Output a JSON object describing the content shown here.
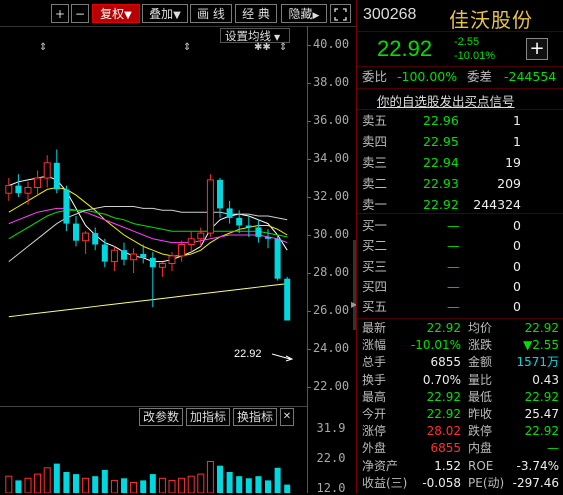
{
  "toolbar": {
    "plus": "+",
    "minus": "−",
    "fuquan": "复权",
    "fuquan_arrow": "▼",
    "diejia": "叠加",
    "diejia_arrow": "▼",
    "huaxian": "画 线",
    "jingdian": "经 典",
    "yincang": "隐藏",
    "yincang_arrow": "▶"
  },
  "chart": {
    "settings_label": "设置均线",
    "settings_arrow": "▼",
    "price_tag": "22.92",
    "axis_ticks": [
      "40.00",
      "38.00",
      "36.00",
      "34.00",
      "32.00",
      "30.00",
      "28.00",
      "26.00",
      "24.00",
      "22.00"
    ],
    "sub_axis_ticks": [
      "31.9",
      "22.0",
      "12.0"
    ],
    "buttons": {
      "params": "改参数",
      "add": "加指标",
      "swap": "换指标",
      "close": "✕"
    },
    "chart_data": {
      "type": "candlestick",
      "ylim": [
        21.0,
        41.0
      ],
      "candles": [
        [
          32.2,
          33.0,
          31.8,
          32.6
        ],
        [
          32.6,
          33.2,
          32.0,
          32.2
        ],
        [
          32.2,
          32.8,
          31.6,
          32.5
        ],
        [
          32.5,
          33.4,
          32.1,
          33.0
        ],
        [
          33.0,
          34.2,
          32.5,
          33.8
        ],
        [
          33.8,
          34.5,
          32.2,
          32.4
        ],
        [
          32.4,
          32.6,
          30.2,
          30.6
        ],
        [
          30.6,
          31.0,
          29.4,
          29.7
        ],
        [
          29.7,
          30.2,
          29.0,
          30.1
        ],
        [
          30.1,
          30.4,
          29.2,
          29.5
        ],
        [
          29.5,
          29.8,
          28.3,
          28.6
        ],
        [
          28.6,
          29.4,
          28.1,
          29.2
        ],
        [
          29.2,
          29.6,
          28.4,
          28.7
        ],
        [
          28.7,
          29.3,
          28.0,
          29.0
        ],
        [
          29.0,
          29.5,
          28.5,
          28.8
        ],
        [
          28.8,
          29.1,
          26.2,
          28.3
        ],
        [
          28.3,
          28.6,
          27.8,
          28.5
        ],
        [
          28.5,
          29.1,
          28.1,
          28.9
        ],
        [
          28.9,
          29.7,
          28.6,
          29.5
        ],
        [
          29.5,
          30.2,
          29.1,
          29.8
        ],
        [
          29.8,
          30.4,
          29.4,
          30.1
        ],
        [
          30.1,
          33.2,
          29.9,
          32.9
        ],
        [
          32.9,
          33.0,
          30.9,
          31.4
        ],
        [
          31.4,
          31.8,
          30.6,
          30.9
        ],
        [
          30.9,
          31.3,
          30.1,
          30.5
        ],
        [
          30.5,
          31.0,
          29.9,
          30.4
        ],
        [
          30.4,
          30.8,
          29.6,
          29.9
        ],
        [
          29.9,
          30.3,
          29.3,
          29.8
        ],
        [
          29.8,
          30.0,
          27.6,
          27.7
        ],
        [
          27.7,
          27.8,
          25.5,
          25.5
        ]
      ],
      "ma": [
        {
          "name": "MA5",
          "color": "#ffffff",
          "values": [
            32.6,
            32.8,
            32.9,
            33.0,
            33.1,
            32.9,
            32.3,
            31.4,
            30.5,
            30.0,
            29.6,
            29.4,
            29.1,
            28.9,
            28.8,
            28.6,
            28.6,
            28.7,
            28.9,
            29.1,
            29.4,
            30.3,
            30.8,
            31.0,
            31.1,
            31.0,
            30.8,
            30.6,
            30.0,
            29.2
          ]
        },
        {
          "name": "MA10",
          "color": "#f0f000",
          "values": [
            31.2,
            31.5,
            31.8,
            32.1,
            32.4,
            32.5,
            32.4,
            32.1,
            31.7,
            31.3,
            30.8,
            30.4,
            30.0,
            29.7,
            29.4,
            29.2,
            29.0,
            28.9,
            28.9,
            29.0,
            29.2,
            29.6,
            29.9,
            30.1,
            30.3,
            30.4,
            30.5,
            30.5,
            30.3,
            30.0
          ]
        },
        {
          "name": "MA20",
          "color": "#ff40ff",
          "values": [
            30.6,
            30.8,
            31.0,
            31.2,
            31.3,
            31.4,
            31.4,
            31.3,
            31.2,
            31.0,
            30.8,
            30.6,
            30.4,
            30.2,
            30.0,
            29.8,
            29.7,
            29.6,
            29.6,
            29.6,
            29.7,
            29.8,
            29.9,
            30.0,
            30.0,
            30.0,
            30.0,
            29.9,
            29.8,
            29.6
          ]
        },
        {
          "name": "MA30",
          "color": "#00e000",
          "values": [
            29.8,
            30.1,
            30.4,
            30.7,
            31.0,
            31.2,
            31.3,
            31.3,
            31.3,
            31.2,
            31.1,
            30.9,
            30.8,
            30.6,
            30.5,
            30.4,
            30.3,
            30.2,
            30.2,
            30.2,
            30.2,
            30.2,
            30.2,
            30.2,
            30.2,
            30.2,
            30.2,
            30.1,
            30.0,
            29.9
          ]
        },
        {
          "name": "MA60",
          "color": "#d0d0d0",
          "values": [
            28.6,
            29.0,
            29.4,
            29.8,
            30.2,
            30.6,
            30.9,
            31.1,
            31.3,
            31.4,
            31.5,
            31.5,
            31.5,
            31.5,
            31.4,
            31.4,
            31.3,
            31.3,
            31.2,
            31.2,
            31.2,
            31.2,
            31.2,
            31.1,
            31.1,
            31.1,
            31.0,
            31.0,
            30.9,
            30.8
          ]
        },
        {
          "name": "MA120",
          "color": "#ffff80",
          "values": [
            25.7,
            25.76,
            25.82,
            25.88,
            25.94,
            26.0,
            26.06,
            26.12,
            26.18,
            26.24,
            26.3,
            26.36,
            26.42,
            26.48,
            26.54,
            26.6,
            26.66,
            26.72,
            26.78,
            26.84,
            26.9,
            26.96,
            27.02,
            27.08,
            27.14,
            27.2,
            27.26,
            27.32,
            27.38,
            27.44
          ]
        }
      ],
      "volumes": [
        8,
        6,
        7,
        9,
        12,
        14,
        10,
        9,
        7,
        8,
        11,
        6,
        7,
        5,
        6,
        9,
        7,
        6,
        7,
        8,
        9,
        15,
        13,
        10,
        8,
        7,
        8,
        6,
        12,
        4
      ],
      "volume_max": 31.9
    }
  },
  "quote": {
    "code": "300268",
    "name": "佳沃股份",
    "price": "22.92",
    "change": "-2.55",
    "change_pct": "-10.01%",
    "add_btn": "+",
    "weibi_label": "委比",
    "weibi_value": "-100.00%",
    "weicha_label": "委差",
    "weicha_value": "-244554",
    "signal": "你的自选股发出买点信号",
    "asks": [
      {
        "label": "卖五",
        "price": "22.96",
        "vol": "1"
      },
      {
        "label": "卖四",
        "price": "22.95",
        "vol": "1"
      },
      {
        "label": "卖三",
        "price": "22.94",
        "vol": "19"
      },
      {
        "label": "卖二",
        "price": "22.93",
        "vol": "209"
      },
      {
        "label": "卖一",
        "price": "22.92",
        "vol": "244324"
      }
    ],
    "bids": [
      {
        "label": "买一",
        "price": "—",
        "vol": "0"
      },
      {
        "label": "买二",
        "price": "—",
        "vol": "0"
      },
      {
        "label": "买三",
        "price": "—",
        "vol": "0"
      },
      {
        "label": "买四",
        "price": "—",
        "vol": "0"
      },
      {
        "label": "买五",
        "price": "—",
        "vol": "0"
      }
    ],
    "stats": [
      {
        "l1": "最新",
        "v1": "22.92",
        "c1": "g",
        "l2": "均价",
        "v2": "22.92",
        "c2": "g"
      },
      {
        "l1": "涨幅",
        "v1": "-10.01%",
        "c1": "g",
        "l2": "涨跌",
        "v2": "▼2.55",
        "c2": "g"
      },
      {
        "l1": "总手",
        "v1": "6855",
        "c1": "w",
        "l2": "金额",
        "v2": "1571万",
        "c2": "c"
      },
      {
        "l1": "换手",
        "v1": "0.70%",
        "c1": "w",
        "l2": "量比",
        "v2": "0.43",
        "c2": "w"
      },
      {
        "l1": "最高",
        "v1": "22.92",
        "c1": "g",
        "l2": "最低",
        "v2": "22.92",
        "c2": "g"
      },
      {
        "l1": "今开",
        "v1": "22.92",
        "c1": "g",
        "l2": "昨收",
        "v2": "25.47",
        "c2": "w"
      },
      {
        "l1": "涨停",
        "v1": "28.02",
        "c1": "r",
        "l2": "跌停",
        "v2": "22.92",
        "c2": "g"
      },
      {
        "l1": "外盘",
        "v1": "6855",
        "c1": "r",
        "l2": "内盘",
        "v2": "—",
        "c2": "g"
      },
      {
        "l1": "净资产",
        "v1": "1.52",
        "c1": "w",
        "l2": "ROE",
        "v2": "-3.74%",
        "c2": "w"
      },
      {
        "l1": "收益(三)",
        "v1": "-0.058",
        "c1": "w",
        "l2": "PE(动)",
        "v2": "-297.46",
        "c2": "w"
      }
    ]
  }
}
